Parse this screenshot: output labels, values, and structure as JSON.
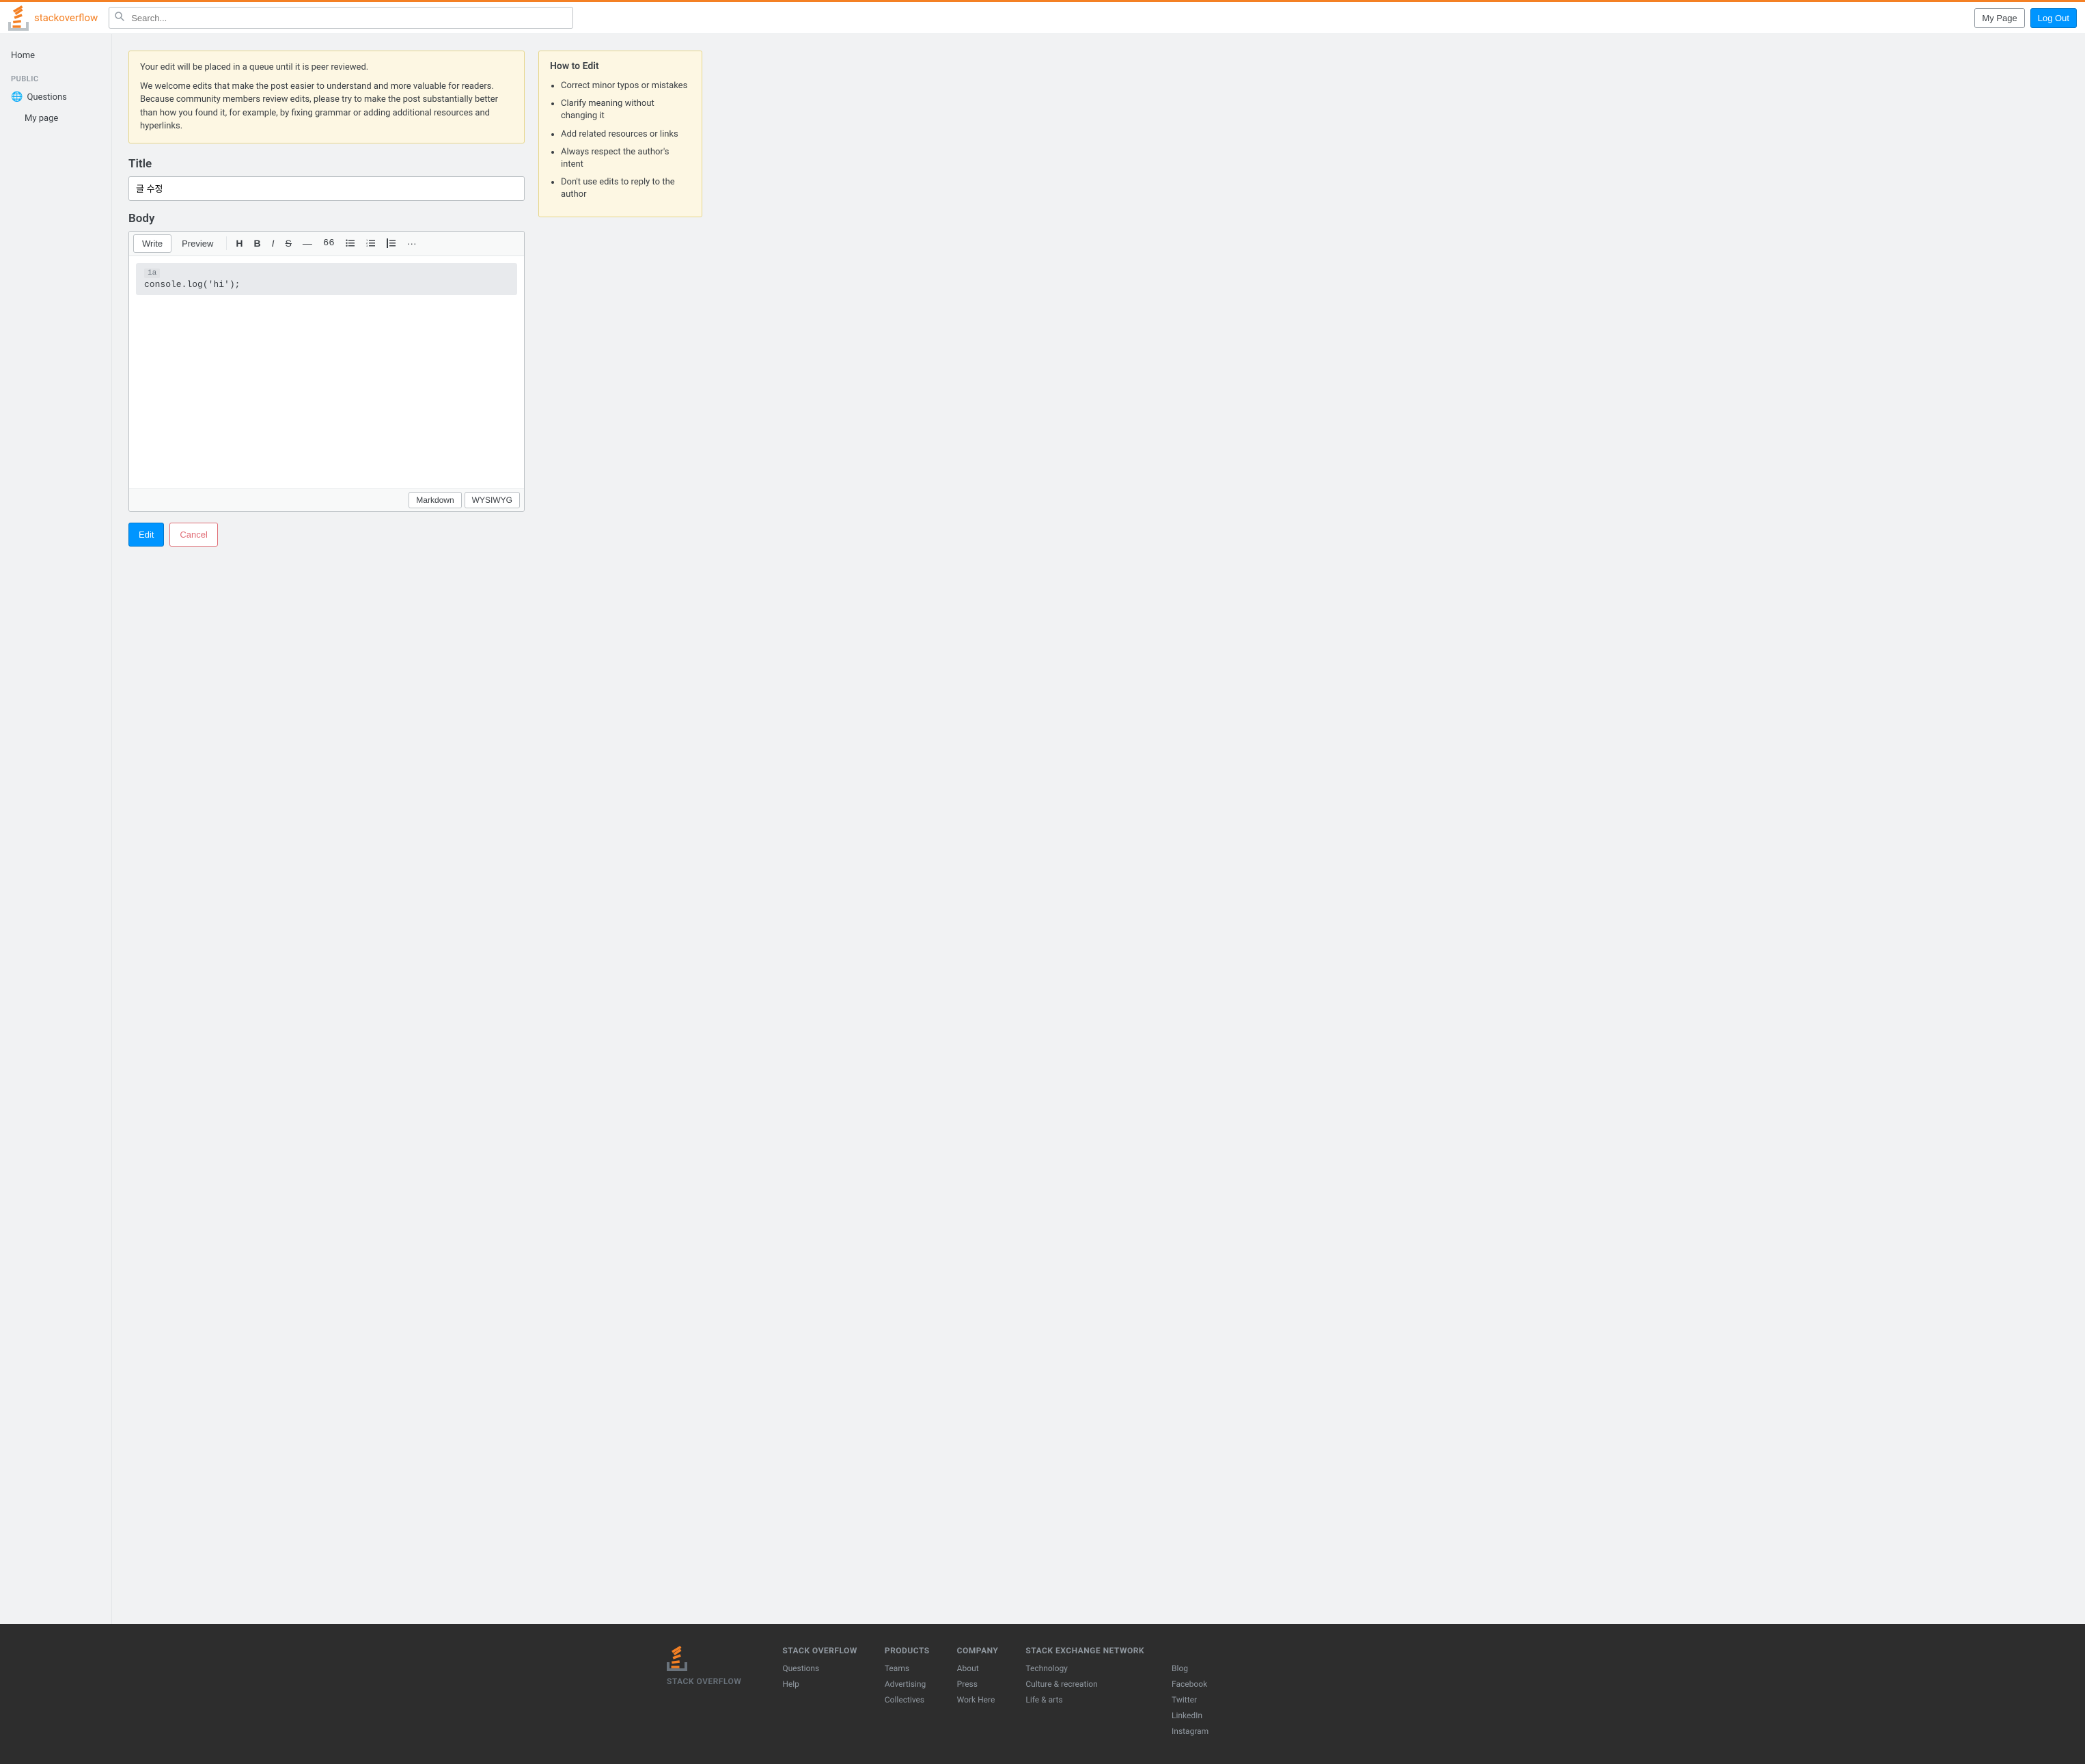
{
  "header": {
    "logo_text_stack": "stack",
    "logo_text_overflow": "overflow",
    "search_placeholder": "Search...",
    "btn_mypage": "My Page",
    "btn_logout": "Log Out"
  },
  "sidebar": {
    "home_label": "Home",
    "public_label": "PUBLIC",
    "questions_label": "Questions",
    "mypage_label": "My page"
  },
  "notice": {
    "line1": "Your edit will be placed in a queue until it is peer reviewed.",
    "line2": "We welcome edits that make the post easier to understand and more valuable for readers. Because community members review edits, please try to make the post substantially better than how you found it, for example, by fixing grammar or adding additional resources and hyperlinks."
  },
  "how_to_edit": {
    "title": "How to Edit",
    "tips": [
      "Correct minor typos or mistakes",
      "Clarify meaning without changing it",
      "Add related resources or links",
      "Always respect the author's intent",
      "Don't use edits to reply to the author"
    ]
  },
  "form": {
    "title_label": "Title",
    "title_value": "글 수정",
    "body_label": "Body",
    "write_tab": "Write",
    "preview_tab": "Preview",
    "toolbar": {
      "heading": "H",
      "bold": "B",
      "italic": "I",
      "strikethrough": "S",
      "divider": "—",
      "number66": "66",
      "list_unordered": "≡",
      "list_ordered": "≡",
      "blockquote": "❝",
      "more": "···"
    },
    "code_line_numbers": [
      "",
      "1a"
    ],
    "code_content": "console.log('hi');",
    "markdown_btn": "Markdown",
    "wysiwyg_btn": "WYSIWYG",
    "edit_btn": "Edit",
    "cancel_btn": "Cancel"
  },
  "footer": {
    "logo_text": "STACK OVERFLOW",
    "cols": [
      {
        "heading": "STACK OVERFLOW",
        "links": [
          "Questions",
          "Help"
        ]
      },
      {
        "heading": "PRODUCTS",
        "links": [
          "Teams",
          "Advertising",
          "Collectives"
        ]
      },
      {
        "heading": "COMPANY",
        "links": [
          "About",
          "Press",
          "Work Here"
        ]
      },
      {
        "heading": "STACK EXCHANGE NETWORK",
        "links": [
          "Technology",
          "Culture & recreation",
          "Life & arts"
        ]
      },
      {
        "heading": "",
        "links": [
          "Blog",
          "Facebook",
          "Twitter",
          "LinkedIn",
          "Instagram"
        ]
      }
    ]
  }
}
